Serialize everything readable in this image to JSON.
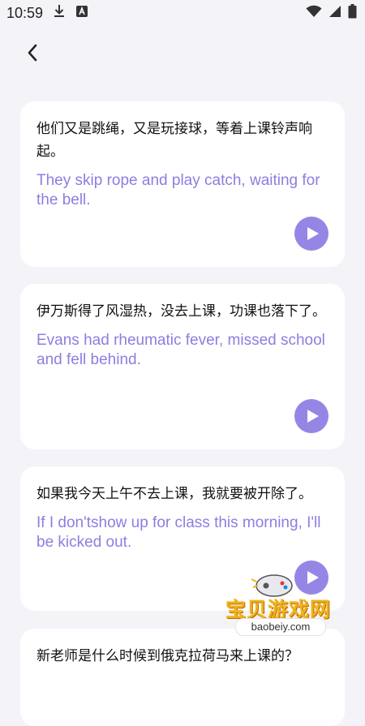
{
  "status_bar": {
    "time": "10:59"
  },
  "cards": [
    {
      "zh": "他们又是跳绳，又是玩接球，等着上课铃声响起。",
      "en": "They skip rope and play catch, waiting for the bell."
    },
    {
      "zh": "伊万斯得了风湿热，没去上课，功课也落下了。",
      "en": "Evans had rheumatic fever, missed school and fell behind."
    },
    {
      "zh": "如果我今天上午不去上课，我就要被开除了。",
      "en": "If I don'tshow up for class this morning, I'll be kicked out."
    },
    {
      "zh": "新老师是什么时候到俄克拉荷马来上课的？"
    }
  ],
  "watermark": {
    "brand": "宝贝游戏网",
    "url": "baobeiy.com"
  },
  "colors": {
    "accent": "#9586e6",
    "english_text": "#8c7ee0",
    "background": "#f4f3f8"
  }
}
